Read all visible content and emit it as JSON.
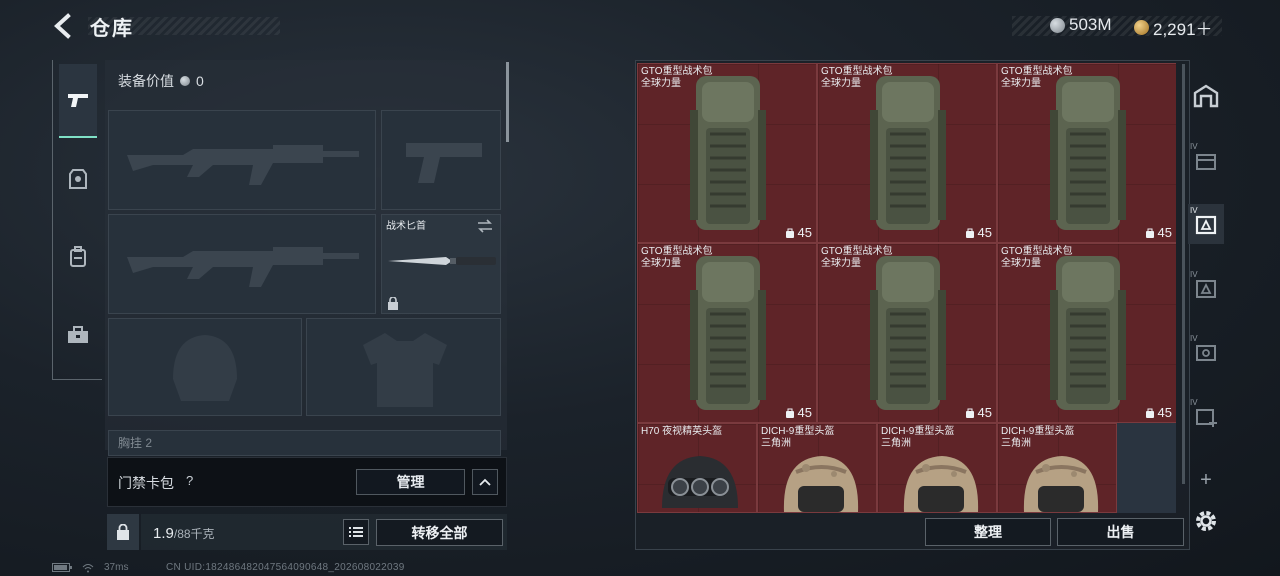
{
  "header": {
    "title": "仓库",
    "currency_silver": "503M",
    "currency_gold": "2,291＋"
  },
  "loadout": {
    "equip_value_label": "装备价值",
    "equip_value": "0",
    "knife_label": "战术匕首",
    "chest_label": "胸挂 2"
  },
  "keycard": {
    "label": "门禁卡包",
    "help": "?",
    "manage_label": "管理"
  },
  "capacity": {
    "weight": "1.9",
    "weight_max": "/88千克",
    "transfer_all_label": "转移全部"
  },
  "status": {
    "ping": "37ms",
    "uid": "CN UID:18248648204756409064​8_202608022039"
  },
  "storage": {
    "sort_label": "整理",
    "sell_label": "出售",
    "items": [
      {
        "line1": "GTO重型战术包",
        "line2": "全球力量",
        "capacity": "45",
        "kind": "backpack"
      },
      {
        "line1": "GTO重型战术包",
        "line2": "全球力量",
        "capacity": "45",
        "kind": "backpack"
      },
      {
        "line1": "GTO重型战术包",
        "line2": "全球力量",
        "capacity": "45",
        "kind": "backpack"
      },
      {
        "line1": "GTO重型战术包",
        "line2": "全球力量",
        "capacity": "45",
        "kind": "backpack"
      },
      {
        "line1": "GTO重型战术包",
        "line2": "全球力量",
        "capacity": "45",
        "kind": "backpack"
      },
      {
        "line1": "GTO重型战术包",
        "line2": "全球力量",
        "capacity": "45",
        "kind": "backpack"
      },
      {
        "line1": "H70 夜视精英头盔",
        "line2": "",
        "capacity": "",
        "kind": "nv-helmet"
      },
      {
        "line1": "DICH-9重型头盔",
        "line2": "三角洲",
        "capacity": "",
        "kind": "helmet"
      },
      {
        "line1": "DICH-9重型头盔",
        "line2": "三角洲",
        "capacity": "",
        "kind": "helmet"
      },
      {
        "line1": "DICH-9重型头盔",
        "line2": "三角洲",
        "capacity": "",
        "kind": "helmet"
      }
    ]
  },
  "rail": {
    "tier_label": "IV",
    "add_label": "+"
  },
  "colors": {
    "accent": "#7fe1c6",
    "item_bg": "#5f2428"
  }
}
